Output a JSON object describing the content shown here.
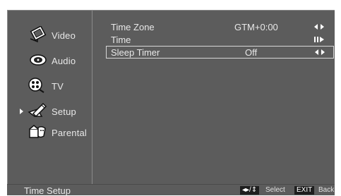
{
  "sidebar": {
    "items": [
      {
        "label": "Video",
        "icon": "video-icon"
      },
      {
        "label": "Audio",
        "icon": "audio-icon"
      },
      {
        "label": "TV",
        "icon": "tv-icon"
      },
      {
        "label": "Setup",
        "icon": "setup-icon",
        "active": true
      },
      {
        "label": "Parental",
        "icon": "parental-icon"
      }
    ]
  },
  "settings": {
    "rows": [
      {
        "name": "Time Zone",
        "value": "GTM+0:00",
        "control": "left-right-arrows-icon"
      },
      {
        "name": "Time",
        "value": "",
        "control": "pause-play-icon"
      },
      {
        "name": "Sleep Timer",
        "value": "Off",
        "control": "left-right-arrows-icon",
        "selected": true
      }
    ]
  },
  "footer": {
    "title": "Time Setup",
    "select_key": "◂▸/⇕",
    "select_label": "Select",
    "back_key": "EXIT",
    "back_label": "Back"
  },
  "colors": {
    "background": "#5c5c5c",
    "text": "#e8e8e8",
    "divider": "#8a8a8a",
    "key_bg": "#1e1e1e"
  }
}
